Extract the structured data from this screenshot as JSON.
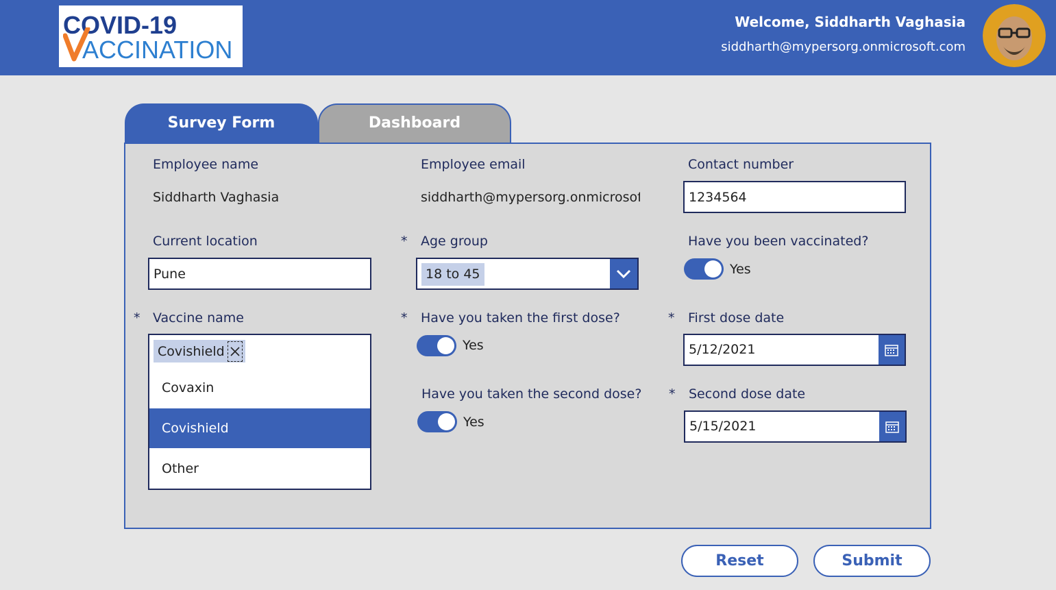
{
  "header": {
    "logo_line1": "COVID-19",
    "logo_line2": "ACCINATION",
    "welcome": "Welcome, Siddharth Vaghasia",
    "email": "siddharth@mypersorg.onmicrosoft.com"
  },
  "tabs": [
    {
      "label": "Survey Form",
      "active": true
    },
    {
      "label": "Dashboard",
      "active": false
    }
  ],
  "form": {
    "employee_name_label": "Employee name",
    "employee_name_value": "Siddharth Vaghasia",
    "employee_email_label": "Employee email",
    "employee_email_value": "siddharth@mypersorg.onmicrosof",
    "contact_number_label": "Contact number",
    "contact_number_value": "1234564",
    "current_location_label": "Current location",
    "current_location_value": "Pune",
    "age_group_label": "Age group",
    "age_group_value": "18 to 45",
    "vaccinated_label": "Have you been vaccinated?",
    "vaccinated_value": "Yes",
    "vaccine_name_label": "Vaccine name",
    "vaccine_selected": "Covishield",
    "vaccine_options": [
      "Covaxin",
      "Covishield",
      "Other"
    ],
    "first_dose_label": "Have you taken the first dose?",
    "first_dose_value": "Yes",
    "second_dose_label": "Have you taken the second dose?",
    "second_dose_value": "Yes",
    "first_dose_date_label": "First dose date",
    "first_dose_date_value": "5/12/2021",
    "second_dose_date_label": "Second dose date",
    "second_dose_date_value": "5/15/2021",
    "required_marker": "*"
  },
  "buttons": {
    "reset": "Reset",
    "submit": "Submit"
  },
  "icons": {
    "chevron": "chevron-down-icon",
    "calendar": "calendar-icon",
    "clear": "close-icon"
  },
  "colors": {
    "primary": "#3a61b6",
    "tab_inactive": "#a6a6a6",
    "label_text": "#1f2a5c"
  }
}
